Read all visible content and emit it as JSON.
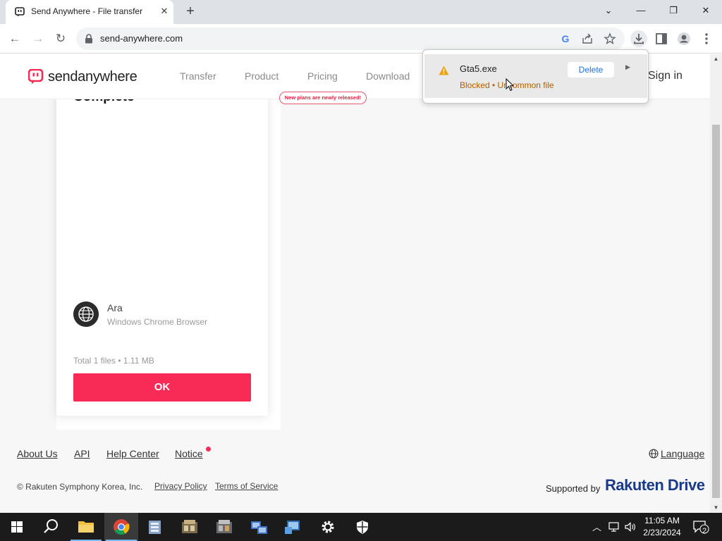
{
  "browser": {
    "tab": {
      "title": "Send Anywhere - File transfer",
      "close_glyph": "✕"
    },
    "new_tab_glyph": "+",
    "window_controls": {
      "tab_search": "⌄",
      "minimize": "—",
      "restore": "❐",
      "close": "✕"
    },
    "nav": {
      "back": "←",
      "forward": "→",
      "reload": "↻"
    },
    "url": "send-anywhere.com",
    "toolbar_icons": [
      "google-icon",
      "share-icon",
      "star-icon",
      "download-icon",
      "side-panel-icon",
      "profile-icon",
      "menu-icon"
    ]
  },
  "site": {
    "logo_text": "sendanywhere",
    "nav": [
      "Transfer",
      "Product",
      "Pricing",
      "Download"
    ],
    "pricing_badge": "New plans are newly released!",
    "signin": "Sign in"
  },
  "card": {
    "title": "Complete",
    "sender_name": "Ara",
    "sender_device": "Windows Chrome Browser",
    "files_summary": "Total 1 files • 1.11 MB",
    "ok_label": "OK"
  },
  "footer": {
    "links": [
      "About Us",
      "API",
      "Help Center",
      "Notice"
    ],
    "language": "Language",
    "copyright": "© Rakuten Symphony Korea, Inc.",
    "privacy": "Privacy Policy",
    "terms": "Terms of Service",
    "supported_by": "Supported by",
    "brand": "Rakuten Drive"
  },
  "download_bubble": {
    "filename": "Gta5.exe",
    "status": "Blocked • Uncommon file",
    "delete_label": "Delete",
    "status_color": "#b06000"
  },
  "taskbar": {
    "apps": [
      "start-icon",
      "search-icon",
      "file-explorer-icon",
      "chrome-icon",
      "app-icon",
      "app-icon",
      "app-icon",
      "app-icon",
      "app-icon",
      "settings-icon",
      "security-icon"
    ],
    "time": "11:05 AM",
    "date": "2/23/2024",
    "notification_count": "2"
  },
  "colors": {
    "accent": "#f72b55",
    "brand_blue": "#1a3a8a",
    "link_blue": "#1a73e8"
  }
}
